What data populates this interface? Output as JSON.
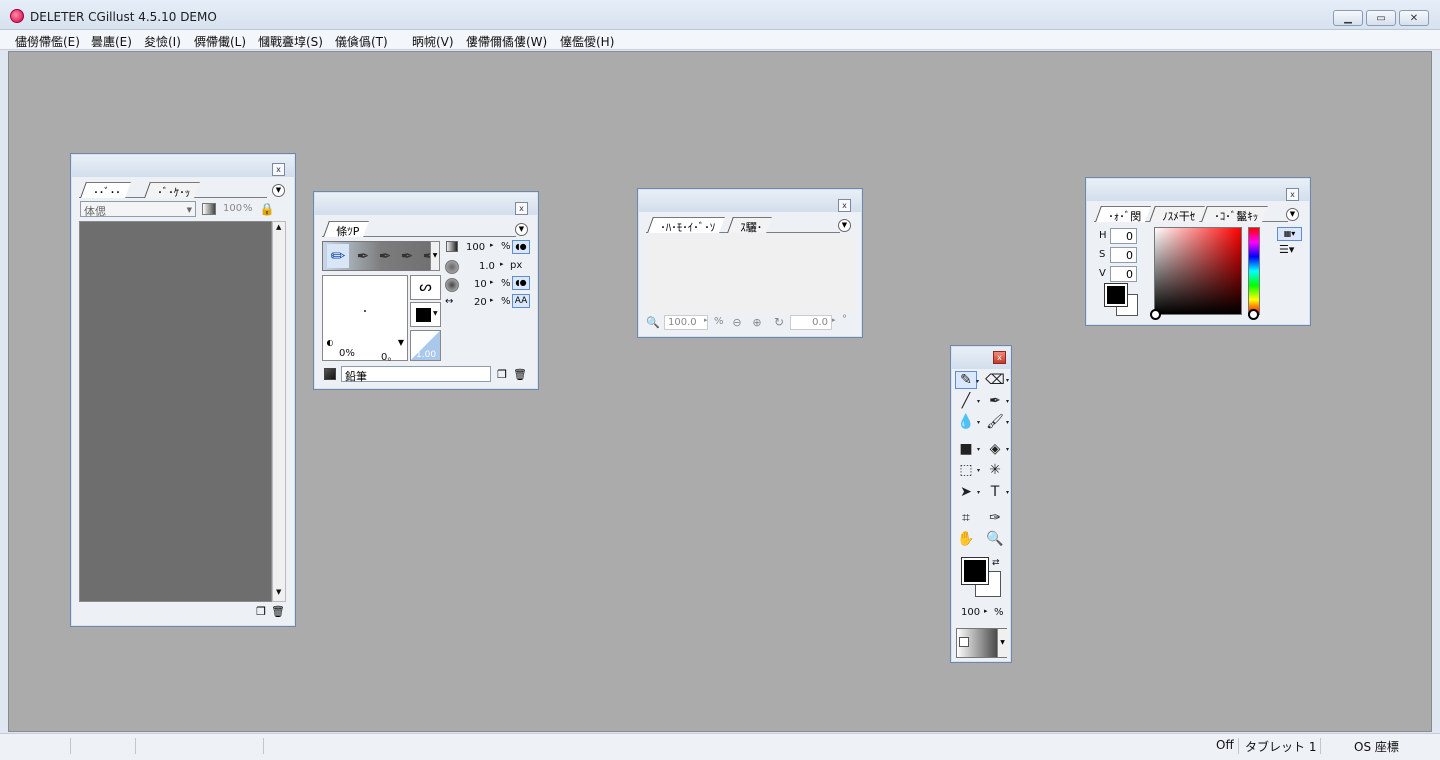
{
  "window": {
    "title": "DELETER CGillust 4.5.10 DEMO"
  },
  "menu": [
    "儘僗僀儖(E)",
    "曇廤(E)",
    "夋憸(I)",
    "僲僀儎(L)",
    "慖戰斖埻(S)",
    "儀僋僞(T)",
    "昞帵(V)",
    "僂僀儞僪僂(W)",
    "僿儖僾(H)"
  ],
  "layer_panel": {
    "tabs": [
      "･･ﾞ･･",
      "･ﾞ･ｹ･ｯ"
    ],
    "mode_value": "体偲",
    "opacity": "100",
    "opacity_unit": "%"
  },
  "brush_panel": {
    "tab": "條ﾂP",
    "opacity": "100",
    "opacity_unit": "%",
    "size": "1.0",
    "size_unit": "px",
    "density": "10",
    "density_unit": "%",
    "spacing": "20",
    "spacing_unit": "%",
    "preview_pct": "0%",
    "preview_val": "0。",
    "curve_value": "1.00",
    "brush_name": "鉛筆"
  },
  "navigator_panel": {
    "tabs": [
      "･ﾊ･ﾓ･ｲ･ﾞ･ｿ",
      "ｽ驪･"
    ],
    "zoom": "100.0",
    "zoom_unit": "%",
    "angle": "0.0",
    "angle_unit": "°"
  },
  "color_panel": {
    "tabs": [
      "･ｫ･ﾞ閔",
      "ﾉｽﾒ干ｾ",
      "･ｺ･ﾞ鬣ｷｯ"
    ],
    "h_label": "H",
    "h_value": "0",
    "s_label": "S",
    "s_value": "0",
    "v_label": "V",
    "v_value": "0",
    "picker_hue_color": "#ff0000"
  },
  "toolbox": {
    "opacity": "100",
    "opacity_unit": "%"
  },
  "status": {
    "left_segments": [
      "",
      "",
      ""
    ],
    "off": "Off",
    "tablet": "タブレット 1",
    "coords": "OS 座標"
  }
}
